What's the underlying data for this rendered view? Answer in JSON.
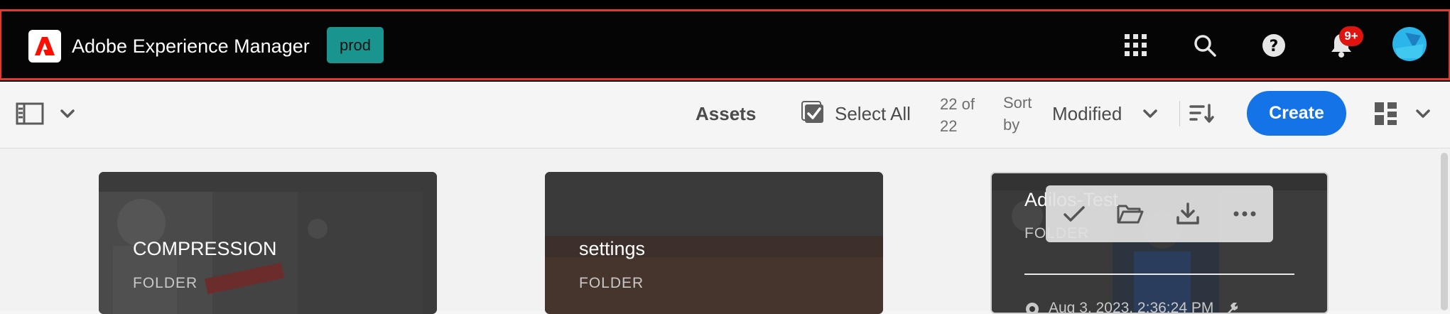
{
  "header": {
    "app_title": "Adobe Experience Manager",
    "env_badge": "prod",
    "notification_count": "9+",
    "icons": [
      "solutions-grid-icon",
      "search-icon",
      "help-icon",
      "bell-icon",
      "avatar"
    ]
  },
  "toolbar": {
    "breadcrumb_title": "Assets",
    "select_all_label": "Select All",
    "count_line1": "22 of",
    "count_line2": "22",
    "sort_line1": "Sort",
    "sort_line2": "by",
    "sort_value": "Modified",
    "create_label": "Create"
  },
  "cards": [
    {
      "title": "COMPRESSION",
      "type": "FOLDER"
    },
    {
      "title": "settings",
      "type": "FOLDER"
    },
    {
      "title": "Adilos-Test",
      "type": "FOLDER",
      "modified": "Aug 3, 2023, 2:36:24 PM"
    }
  ],
  "colors": {
    "accent": "#1473e6",
    "header_bg": "#050505",
    "header_border": "#e3382a",
    "env_badge": "#1a948f",
    "notification": "#e0140f"
  }
}
